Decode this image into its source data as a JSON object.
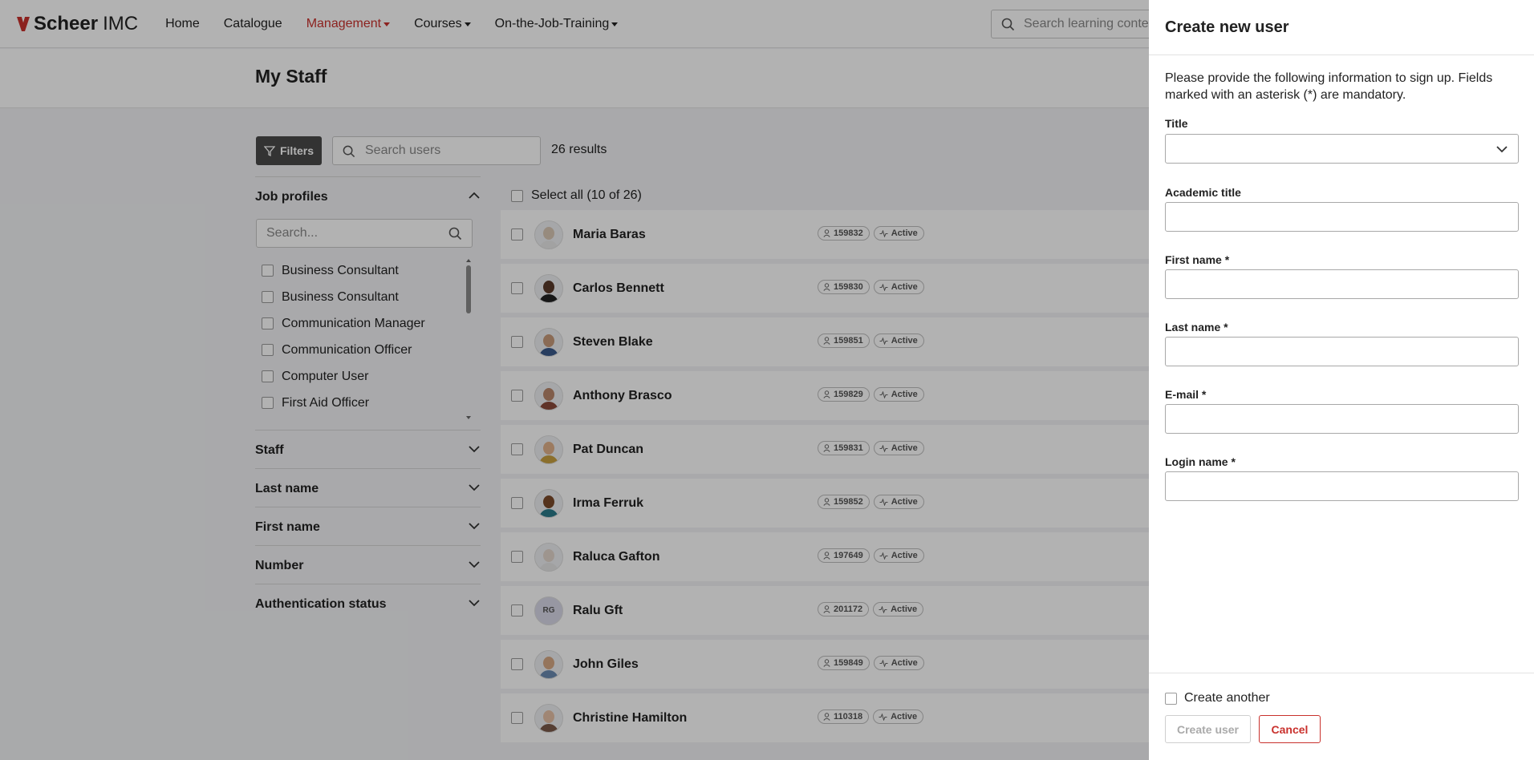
{
  "brand": {
    "name_bold": "Scheer",
    "name_light": "IMC",
    "accent": "#c9312d"
  },
  "nav": {
    "items": [
      {
        "label": "Home"
      },
      {
        "label": "Catalogue"
      },
      {
        "label": "Management"
      },
      {
        "label": "Courses"
      },
      {
        "label": "On-the-Job-Training"
      }
    ],
    "search_placeholder": "Search learning content"
  },
  "page": {
    "title": "My Staff"
  },
  "toolbar": {
    "filters_label": "Filters",
    "search_placeholder": "Search users",
    "results": "26 results"
  },
  "filters": {
    "job_profiles": {
      "label": "Job profiles",
      "search_placeholder": "Search...",
      "items": [
        "Business Consultant",
        "Business Consultant",
        "Communication Manager",
        "Communication Officer",
        "Computer User",
        "First Aid Officer"
      ]
    },
    "sections": [
      "Staff",
      "Last name",
      "First name",
      "Number",
      "Authentication status"
    ]
  },
  "users": {
    "select_all": "Select all (10 of 26)",
    "status_label": "Active",
    "rows": [
      {
        "name": "Maria Baras",
        "number": "159832"
      },
      {
        "name": "Carlos Bennett",
        "number": "159830"
      },
      {
        "name": "Steven Blake",
        "number": "159851"
      },
      {
        "name": "Anthony Brasco",
        "number": "159829"
      },
      {
        "name": "Pat Duncan",
        "number": "159831"
      },
      {
        "name": "Irma Ferruk",
        "number": "159852"
      },
      {
        "name": "Raluca Gafton",
        "number": "197649"
      },
      {
        "name": "Ralu Gft",
        "number": "201172",
        "initials": "RG"
      },
      {
        "name": "John Giles",
        "number": "159849"
      },
      {
        "name": "Christine Hamilton",
        "number": "110318"
      }
    ]
  },
  "drawer": {
    "title": "Create new user",
    "intro": "Please provide the following information to sign up. Fields marked with an asterisk (*) are mandatory.",
    "fields": [
      {
        "label": "Title",
        "value": ""
      },
      {
        "label": "Academic title",
        "value": ""
      },
      {
        "label": "First name *",
        "value": ""
      },
      {
        "label": "Last name *",
        "value": ""
      },
      {
        "label": "E-mail *",
        "value": ""
      },
      {
        "label": "Login name *",
        "value": ""
      }
    ],
    "create_another": "Create another",
    "create_button": "Create user",
    "cancel_button": "Cancel"
  }
}
